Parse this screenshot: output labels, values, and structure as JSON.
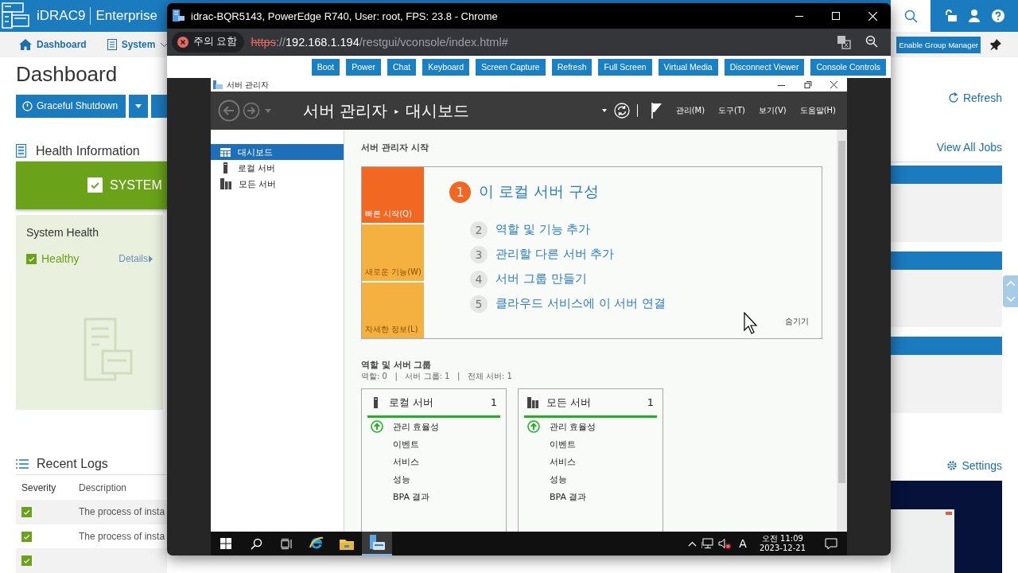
{
  "idrac": {
    "header": {
      "product": "iDRAC9",
      "edition": "Enterprise"
    },
    "nav": [
      {
        "label": "Dashboard",
        "kind": "home"
      },
      {
        "label": "System",
        "kind": "menu"
      }
    ],
    "group_manager_button": "Enable Group Manager",
    "page_title": "Dashboard",
    "power_button": "Graceful Shutdown",
    "health": {
      "title": "Health Information",
      "banner": "SYSTEM",
      "banner_ok": true,
      "panel_title": "System Health",
      "status": "Healthy",
      "status_ok": true,
      "details_link": "Details"
    },
    "logs": {
      "title": "Recent Logs",
      "columns": [
        "Severity",
        "Description"
      ],
      "rows": [
        {
          "ok": true,
          "description": "The process of insta"
        },
        {
          "ok": true,
          "description": "The process of insta"
        },
        {
          "ok": true
        }
      ]
    },
    "refresh_link": "Refresh",
    "jobs_link": "View All Jobs",
    "settings_link": "Settings"
  },
  "chrome": {
    "title": "idrac-BQR5143, PowerEdge R740, User: root, FPS: 23.8 - Chrome",
    "security_chip": "주의 요함",
    "url": {
      "scheme": "https",
      "separator": "://",
      "host": "192.168.1.194",
      "path": "/restgui/vconsole/index.html#"
    },
    "toolbar_buttons": [
      "Boot",
      "Power",
      "Chat",
      "Keyboard",
      "Screen Capture",
      "Refresh",
      "Full Screen",
      "Virtual Media",
      "Disconnect Viewer",
      "Console Controls"
    ]
  },
  "server_manager": {
    "window_title": "서버 관리자",
    "breadcrumb": [
      "서버 관리자",
      "대시보드"
    ],
    "breadcrumb_separator": "▸",
    "menus": [
      "관리(M)",
      "도구(T)",
      "보기(V)",
      "도움말(H)"
    ],
    "nav": [
      {
        "label": "대시보드",
        "kind": "dashboard",
        "selected": true
      },
      {
        "label": "로컬 서버",
        "kind": "server",
        "selected": false
      },
      {
        "label": "모든 서버",
        "kind": "servers",
        "selected": false
      }
    ],
    "welcome": {
      "title": "서버 관리자 시작",
      "tiles": [
        {
          "label": "빠른 시작(Q)",
          "selected": true
        },
        {
          "label": "새로운 기능(W)",
          "selected": false
        },
        {
          "label": "자세한 정보(L)",
          "selected": false
        }
      ],
      "steps": [
        {
          "number": "1",
          "label": "이 로컬 서버 구성",
          "kind": "primary"
        },
        {
          "number": "2",
          "label": "역할 및 기능 추가",
          "kind": "secondary"
        },
        {
          "number": "3",
          "label": "관리할 다른 서버 추가",
          "kind": "secondary"
        },
        {
          "number": "4",
          "label": "서버 그룹 만들기",
          "kind": "secondary"
        },
        {
          "number": "5",
          "label": "클라우드 서비스에 이 서버 연결",
          "kind": "secondary"
        }
      ],
      "hide_link": "숨기기"
    },
    "roles": {
      "title": "역할 및 서버 그룹",
      "summary": "역할: 0   |   서버 그룹: 1   |   전체 서버: 1",
      "cards": [
        {
          "title": "로컬 서버",
          "kind": "server",
          "count": "1",
          "items": [
            {
              "label": "관리 효율성",
              "ok": true
            },
            {
              "label": "이벤트",
              "ok": false
            },
            {
              "label": "서비스",
              "ok": false
            },
            {
              "label": "성능",
              "ok": false
            },
            {
              "label": "BPA 결과",
              "ok": false
            }
          ]
        },
        {
          "title": "모든 서버",
          "kind": "servers",
          "count": "1",
          "items": [
            {
              "label": "관리 효율성",
              "ok": true
            },
            {
              "label": "이벤트",
              "ok": false
            },
            {
              "label": "서비스",
              "ok": false
            },
            {
              "label": "성능",
              "ok": false
            },
            {
              "label": "BPA 결과",
              "ok": false
            }
          ]
        }
      ]
    }
  },
  "taskbar": {
    "apps": [
      {
        "kind": "start",
        "selected": false
      },
      {
        "kind": "search",
        "selected": false
      },
      {
        "kind": "task-view",
        "selected": false
      },
      {
        "kind": "browser",
        "selected": false
      },
      {
        "kind": "folder",
        "selected": false
      },
      {
        "kind": "server-manager",
        "selected": true
      }
    ],
    "ime": "A",
    "volume_muted": true,
    "time": "오전 11:09",
    "date": "2023-12-21"
  }
}
